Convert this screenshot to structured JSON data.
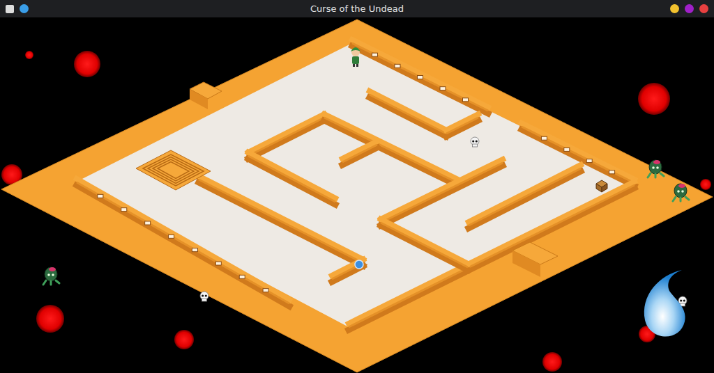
{
  "window": {
    "title": "Curse of the Undead",
    "controls": [
      {
        "color": "#f2c12e"
      },
      {
        "color": "#a020c8"
      },
      {
        "color": "#e84040"
      }
    ]
  }
}
